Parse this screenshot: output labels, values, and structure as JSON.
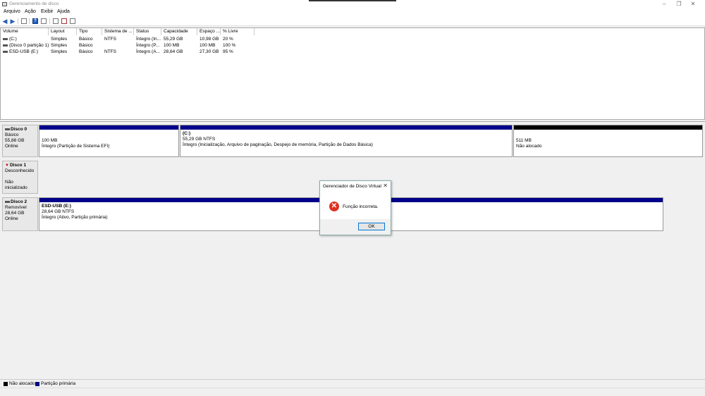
{
  "window": {
    "title": "Gerenciamento de disco"
  },
  "menu": [
    "Arquivo",
    "Ação",
    "Exibir",
    "Ajuda"
  ],
  "volume_list": {
    "columns": [
      "Volume",
      "Layout",
      "Tipo",
      "Sistema de ...",
      "Status",
      "Capacidade",
      "Espaço ...",
      "% Livre"
    ],
    "rows": [
      [
        "(C:)",
        "Simples",
        "Básico",
        "NTFS",
        "Íntegro (In...",
        "55,29 GB",
        "10,98 GB",
        "20 %"
      ],
      [
        "(Disco 0 partição 1)",
        "Simples",
        "Básico",
        "",
        "Íntegro (P...",
        "100 MB",
        "100 MB",
        "100 %"
      ],
      [
        "ESD-USB (E:)",
        "Simples",
        "Básico",
        "NTFS",
        "Íntegro (A...",
        "28,64 GB",
        "27,30 GB",
        "95 %"
      ]
    ]
  },
  "disks": [
    {
      "name": "Disco 0",
      "type": "Básico",
      "size": "55,88 GB",
      "status": "Online",
      "partitions": [
        {
          "title": "",
          "line1": "100 MB",
          "line2": "Íntegro (Partição de Sistema EFI)"
        },
        {
          "title": "(C:)",
          "line1": "55,29 GB NTFS",
          "line2": "Íntegro (Inicialização, Arquivo de paginação, Despejo de memória, Partição de Dados Básica)"
        },
        {
          "title": "",
          "line1": "511 MB",
          "line2": "Não alocado"
        }
      ]
    },
    {
      "name": "Disco 1",
      "type": "Desconhecido",
      "size": "",
      "status": "Não inicializado",
      "partitions": []
    },
    {
      "name": "Disco 2",
      "type": "Removível",
      "size": "28,64 GB",
      "status": "Online",
      "partitions": [
        {
          "title": "ESD-USB (E:)",
          "line1": "28,64 GB NTFS",
          "line2": "Íntegro (Ativo, Partição primária)"
        }
      ]
    }
  ],
  "legend": [
    {
      "label": "Não alocado",
      "color": "#000000"
    },
    {
      "label": "Partição primária",
      "color": "#00008b"
    }
  ],
  "dialog": {
    "title": "Gerenciador de Disco Virtual",
    "message": "Função incorreta.",
    "ok_label": "OK"
  }
}
